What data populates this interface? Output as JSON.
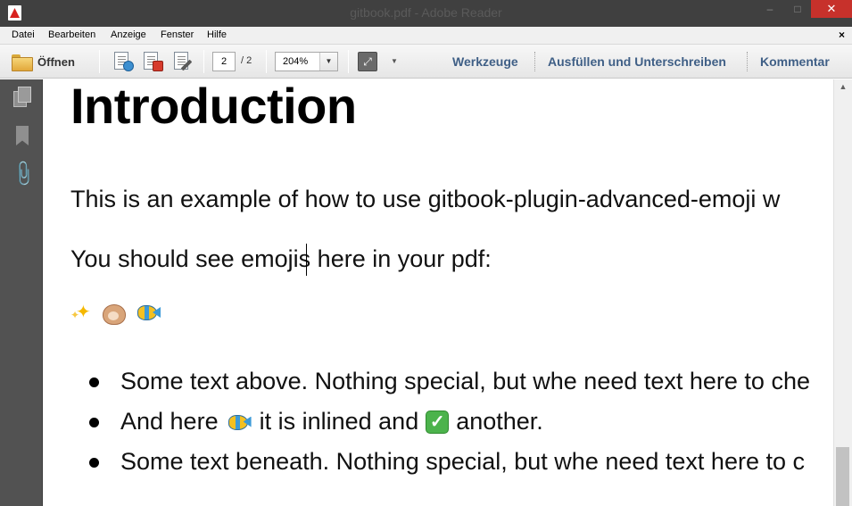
{
  "window": {
    "title": "gitbook.pdf - Adobe Reader",
    "minimize": "–",
    "maximize": "□",
    "close": "✕"
  },
  "menu": {
    "items": [
      "Datei",
      "Bearbeiten",
      "Anzeige",
      "Fenster",
      "Hilfe"
    ],
    "close": "×"
  },
  "toolbar": {
    "open_label": "Öffnen",
    "page_current": "2",
    "page_total": "/ 2",
    "zoom": "204%",
    "dropdown_arrow": "▼",
    "links": [
      "Werkzeuge",
      "Ausfüllen und Unterschreiben",
      "Kommentar"
    ]
  },
  "icons": {
    "toolbar": [
      "create-pdf-icon",
      "export-pdf-icon",
      "sign-icon"
    ],
    "nav": [
      "pages-icon",
      "bookmarks-icon",
      "attachments-icon"
    ]
  },
  "colors": {
    "titlebar": "#404040",
    "close_button": "#c7312b",
    "link": "#3f5f86",
    "nav_panel": "#525252"
  },
  "document": {
    "heading": "Introduction",
    "paragraph1": "This is an example of how to use gitbook-plugin-advanced-emoji w",
    "paragraph2": "You should see emojis here in your pdf:",
    "emoji_row": [
      "sparkles",
      "hamster",
      "tropical_fish"
    ],
    "list": [
      {
        "text": "Some text above. Nothing special, but whe need text here to che"
      },
      {
        "before": "And here",
        "middle": "it is inlined and",
        "after": "another."
      },
      {
        "text": "Some text beneath. Nothing special, but whe need text here to c"
      }
    ]
  },
  "scrollbar": {
    "up_arrow": "▲"
  }
}
